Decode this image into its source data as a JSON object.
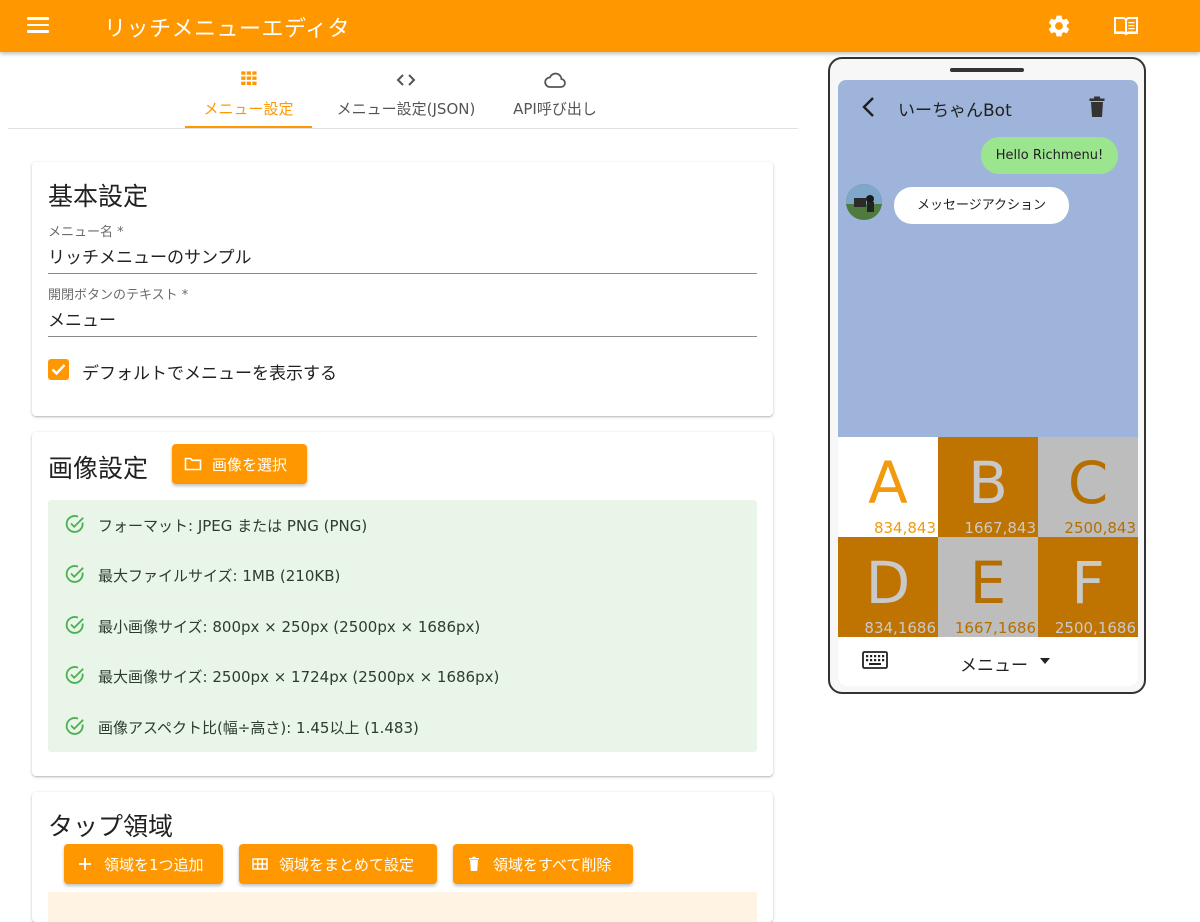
{
  "app": {
    "title": "リッチメニューエディタ"
  },
  "tabs": [
    {
      "label": "メニュー設定",
      "icon": "grid-icon",
      "active": true
    },
    {
      "label": "メニュー設定(JSON)",
      "icon": "code-icon",
      "active": false
    },
    {
      "label": "API呼び出し",
      "icon": "cloud-icon",
      "active": false
    }
  ],
  "basic": {
    "heading": "基本設定",
    "menu_name_label": "メニュー名 *",
    "menu_name_value": "リッチメニューのサンプル",
    "chat_bar_label": "開閉ボタンのテキスト *",
    "chat_bar_value": "メニュー",
    "default_show_label": "デフォルトでメニューを表示する",
    "default_show_checked": true
  },
  "image": {
    "heading": "画像設定",
    "select_button": "画像を選択",
    "requirements": [
      "フォーマット: JPEG または PNG (PNG)",
      "最大ファイルサイズ: 1MB (210KB)",
      "最小画像サイズ: 800px × 250px (2500px × 1686px)",
      "最大画像サイズ: 2500px × 1724px (2500px × 1686px)",
      "画像アスペクト比(幅÷高さ): 1.45以上 (1.483)"
    ]
  },
  "tap": {
    "heading": "タップ領域",
    "add_one": "領域を1つ追加",
    "bulk_set": "領域をまとめて設定",
    "delete_all": "領域をすべて削除"
  },
  "preview": {
    "bot_name": "いーちゃんBot",
    "sent_message": "Hello Richmenu!",
    "received_message": "メッセージアクション",
    "menu_label": "メニュー",
    "cells": [
      {
        "letter": "A",
        "coord": "834,843"
      },
      {
        "letter": "B",
        "coord": "1667,843"
      },
      {
        "letter": "C",
        "coord": "2500,843"
      },
      {
        "letter": "D",
        "coord": "834,1686"
      },
      {
        "letter": "E",
        "coord": "1667,1686"
      },
      {
        "letter": "F",
        "coord": "2500,1686"
      }
    ]
  },
  "colors": {
    "accent": "#ff9800",
    "chat_background": "#9fb4da",
    "sent_bubble": "#9ce58f",
    "requirements_background": "#e9f5e9",
    "check_green": "#4caf50"
  }
}
